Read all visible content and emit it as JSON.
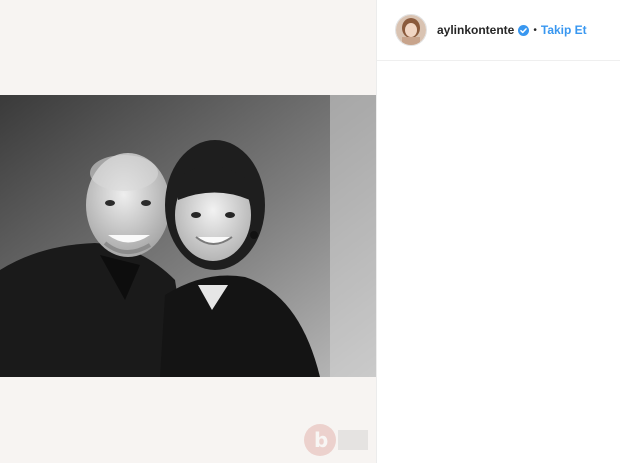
{
  "post": {
    "username": "aylinkontente",
    "separator": "•",
    "follow_label": "Takip Et",
    "follow_color": "#3897f0"
  },
  "icons": {
    "verified": "verified-badge-icon",
    "watermark": "watermark-logo"
  }
}
